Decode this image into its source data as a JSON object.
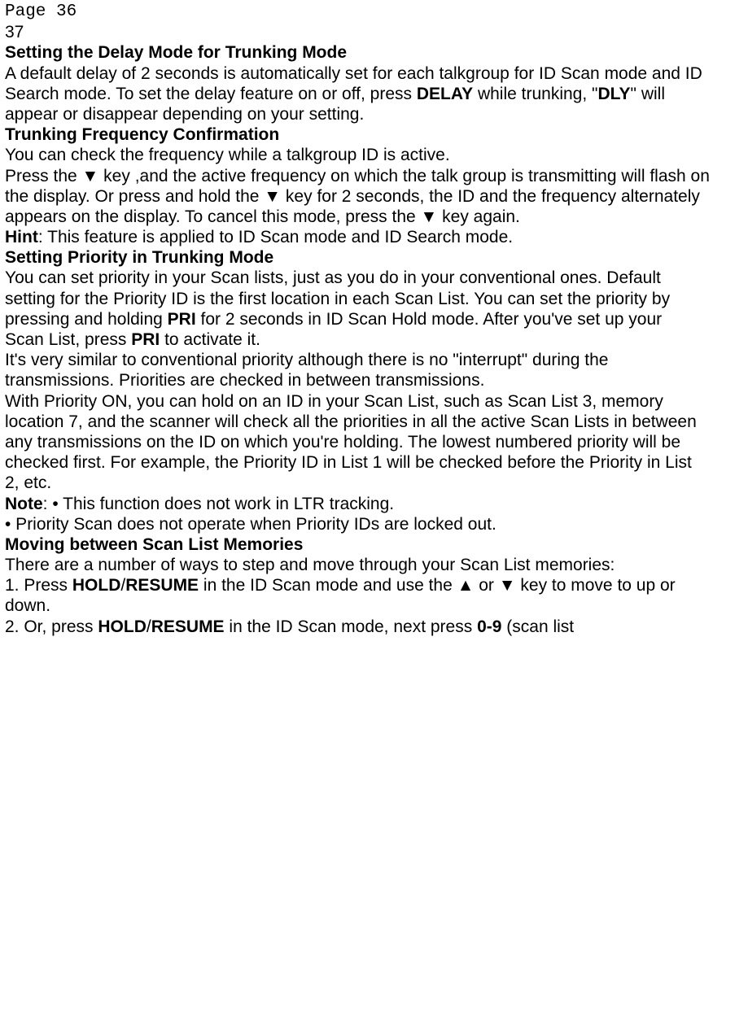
{
  "page_header": "Page 36",
  "page_num": "37",
  "s1_title": "Setting the Delay Mode for Trunking Mode",
  "s1_l1": "A default delay of 2 seconds is automatically set for each talkgroup for ID Scan mode and ID",
  "s1_l2a": "Search mode. To set the delay feature on or off, press ",
  "s1_l2b": "DELAY",
  "s1_l2c": " while trunking, \"",
  "s1_l2d": "DLY",
  "s1_l2e": "\" will",
  "s1_l3": "appear or disappear depending on your setting.",
  "s2_title": "Trunking Frequency Confirmation",
  "s2_l1": "You can check the frequency while a talkgroup ID is active.",
  "s2_l2a": "Press the ",
  "s2_l2b": "▼",
  "s2_l2c": "    key ,and the active frequency on which the talk group is transmitting will flash on",
  "s2_l3a": "the display. Or press and hold the ",
  "s2_l3b": "▼",
  "s2_l3c": "    key for 2 seconds, the ID and the frequency alternately",
  "s2_l4a": "appears on the display. To cancel this mode, press the ",
  "s2_l4b": "▼",
  "s2_l4c": "    key again.",
  "s2_l5a": "Hint",
  "s2_l5b": ": This feature is applied to ID Scan mode and ID Search mode.",
  "s3_title": "Setting Priority in Trunking Mode",
  "s3_l1": "You can set priority in your Scan lists, just as you do in your conventional ones. Default",
  "s3_l2": "setting for the Priority ID is the first location in each Scan List. You can set the priority by",
  "s3_l3a": "pressing and holding ",
  "s3_l3b": "PRI",
  "s3_l3c": " for 2 seconds in ID Scan Hold mode. After you've set up your",
  "s3_l4a": "Scan List, press ",
  "s3_l4b": "PRI",
  "s3_l4c": " to activate it.",
  "s3_l5": "It's very similar to conventional priority although there is no \"interrupt\" during the",
  "s3_l6": "transmissions. Priorities are checked in between transmissions.",
  "s3_l7": "With Priority ON, you can hold on an ID in your Scan List, such as Scan List 3, memory",
  "s3_l8": "location 7, and the scanner will check all the priorities in all the active Scan Lists in between",
  "s3_l9": "any transmissions on the ID on which you're holding. The lowest numbered priority will be",
  "s3_l10": "checked first. For example, the Priority ID in List 1 will be checked before the Priority in List",
  "s3_l11": "2, etc.",
  "s3_l12a": "Note",
  "s3_l12b": ": • This function does not work in LTR tracking.",
  "s3_l13": "• Priority Scan does not operate when Priority IDs are locked out.",
  "s4_title": "Moving between Scan List Memories",
  "s4_l1": "There are a number of ways to step and move through your Scan List memories:",
  "s4_l2a": "1. Press ",
  "s4_l2b": "HOLD",
  "s4_l2c": "/",
  "s4_l2d": "RESUME",
  "s4_l2e": " in the ID Scan mode and use the ",
  "s4_l2f": "▲",
  "s4_l2g": "    or ",
  "s4_l2h": "▼",
  "s4_l2i": "    key to move to up or",
  "s4_l3": "down.",
  "s4_l4a": "2. Or, press ",
  "s4_l4b": "HOLD",
  "s4_l4c": "/",
  "s4_l4d": "RESUME",
  "s4_l4e": " in the ID Scan mode, next press ",
  "s4_l4f": "0-9",
  "s4_l4g": " (scan list"
}
